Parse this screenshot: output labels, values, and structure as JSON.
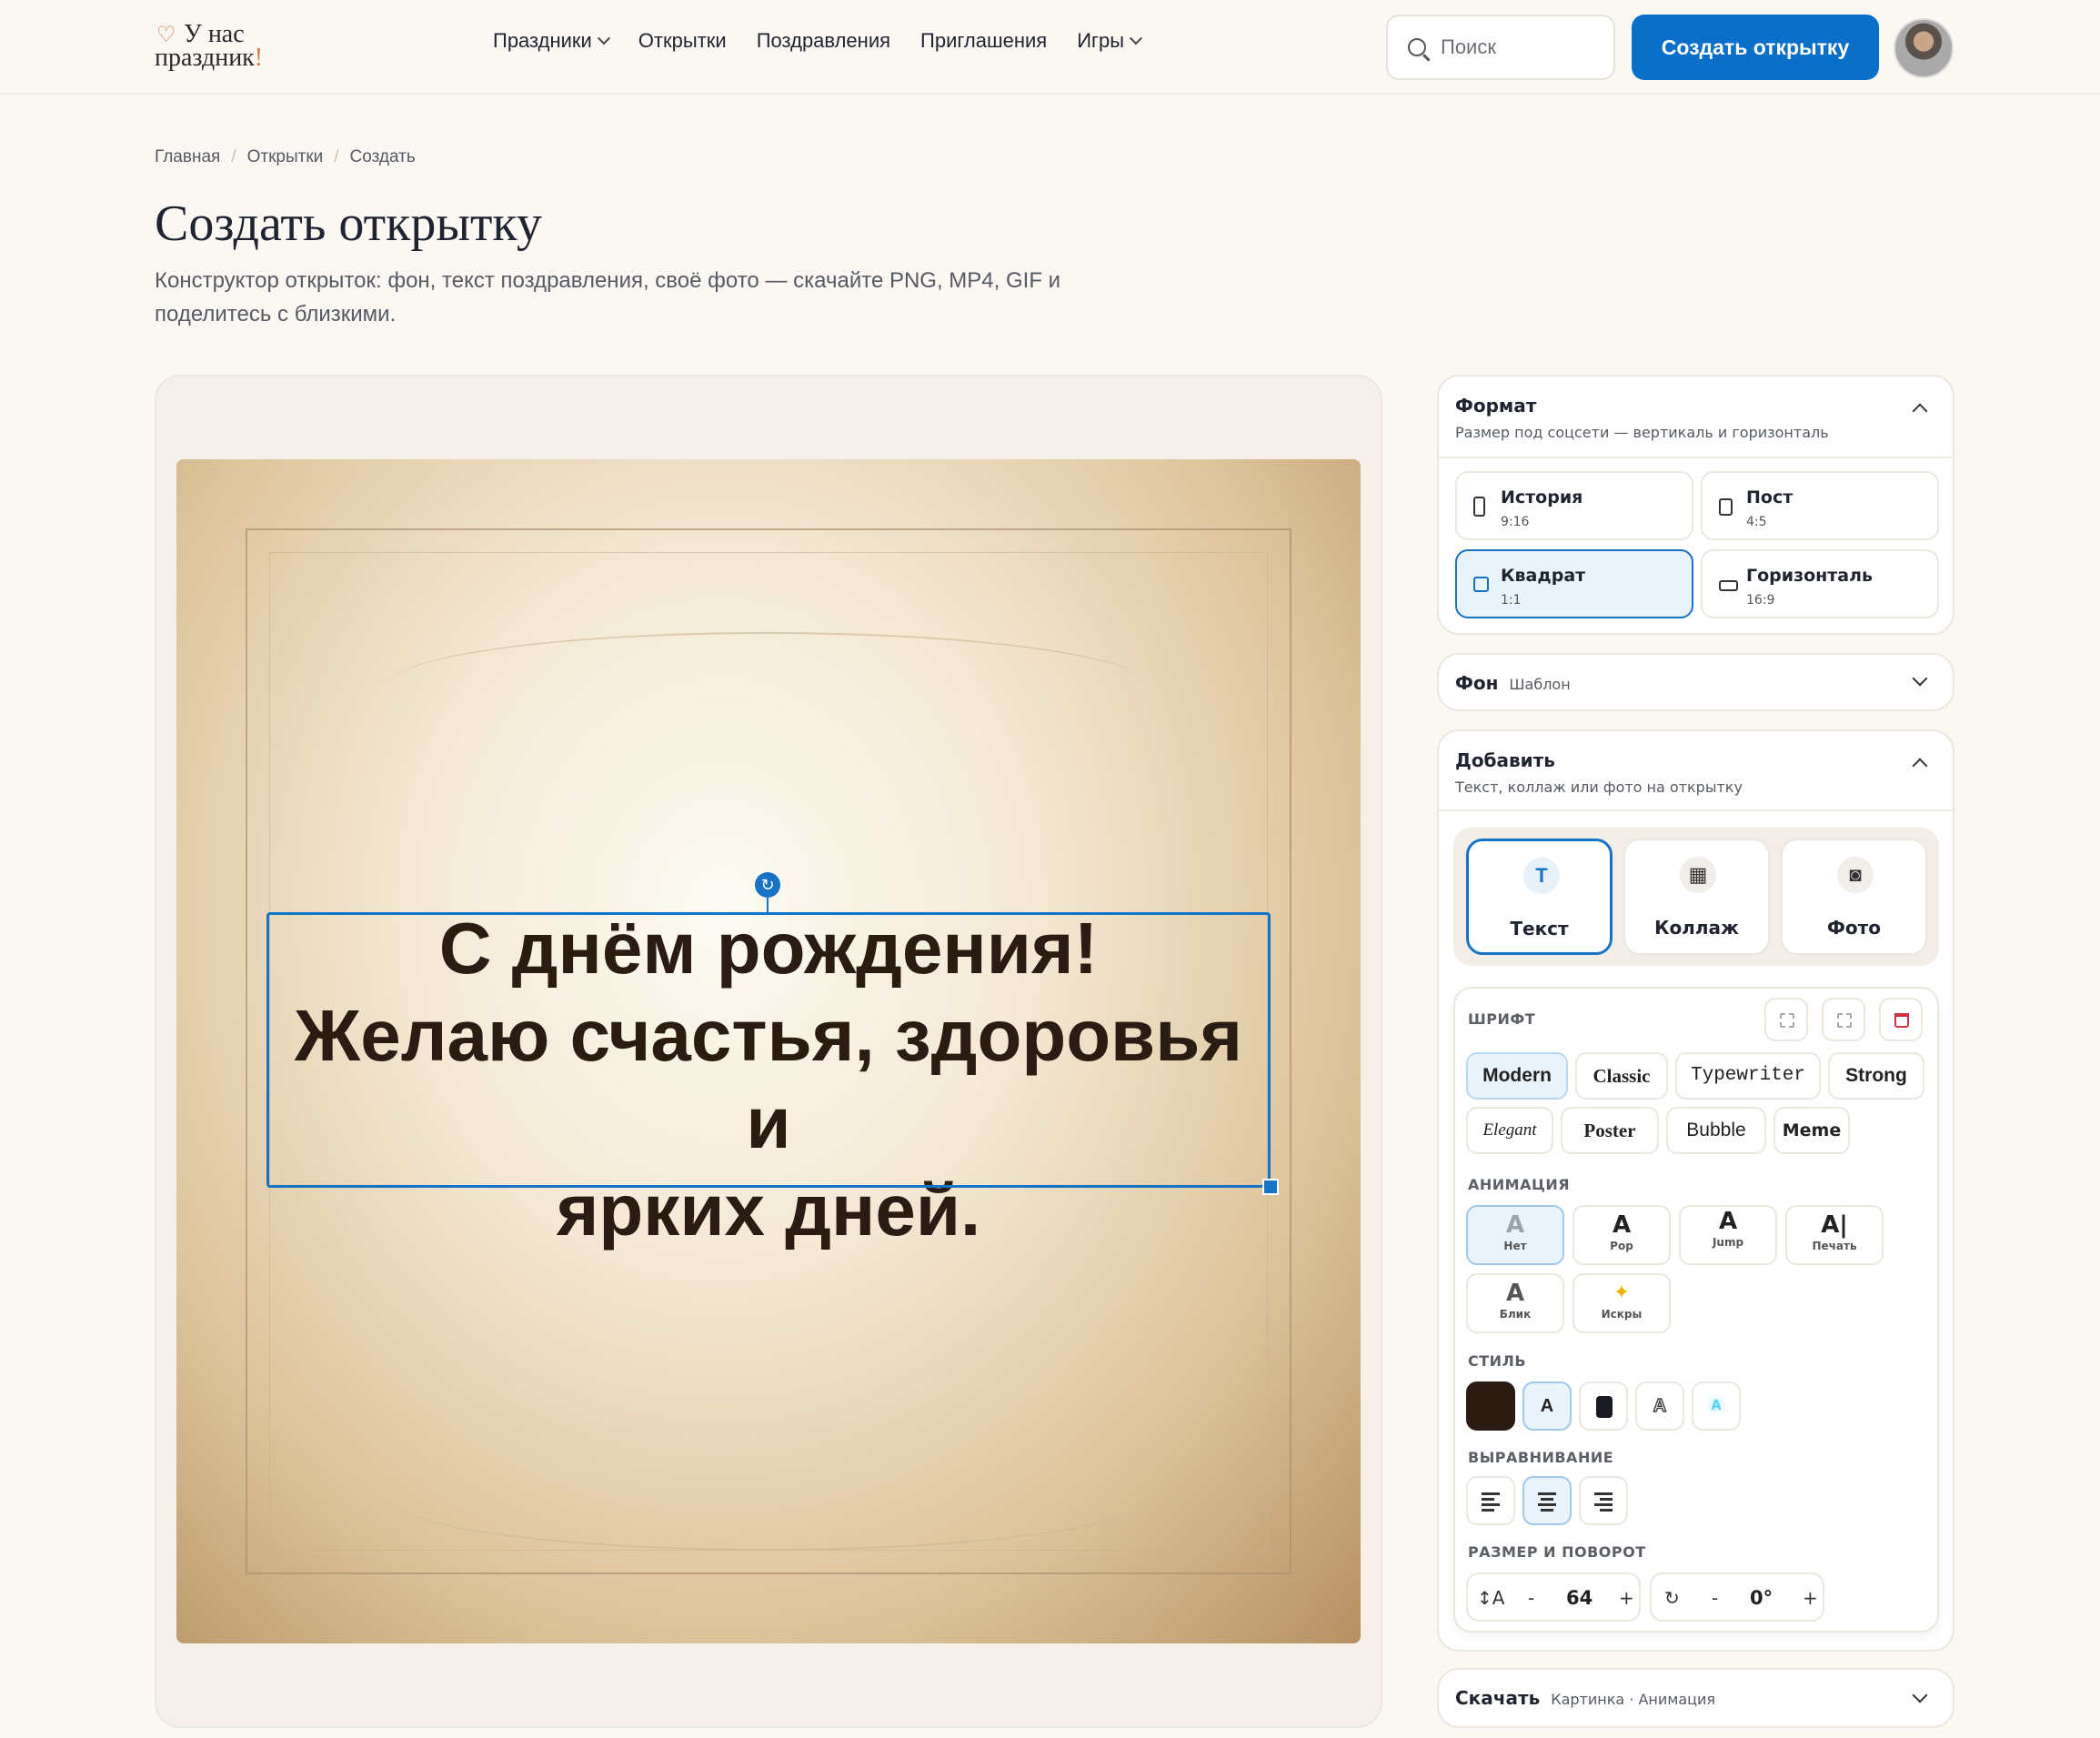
{
  "header": {
    "logo_line1": "У нас",
    "logo_line2": "праздник",
    "logo_bang": "!",
    "nav": [
      "Праздники",
      "Открытки",
      "Поздравления",
      "Приглашения",
      "Игры"
    ],
    "search_placeholder": "Поиск",
    "create_button": "Создать открытку",
    "colors": {
      "accent": "#0a6fc9",
      "logo_accent": "#d8774e"
    }
  },
  "breadcrumbs": [
    "Главная",
    "Открытки",
    "Создать"
  ],
  "page": {
    "title": "Создать открытку",
    "subtitle": "Конструктор открыток: фон, текст поздравления, своё фото — скачайте PNG, MP4, GIF и поделитесь с близкими."
  },
  "card": {
    "text_lines": [
      "С днём рождения!",
      "Желаю счастья, здоровья и",
      "ярких дней."
    ]
  },
  "sidebar": {
    "format": {
      "title": "Формат",
      "subtitle": "Размер под соцсети — вертикаль и горизонталь",
      "options": [
        {
          "name": "История",
          "ratio": "9:16"
        },
        {
          "name": "Пост",
          "ratio": "4:5"
        },
        {
          "name": "Квадрат",
          "ratio": "1:1"
        },
        {
          "name": "Горизонталь",
          "ratio": "16:9"
        }
      ],
      "selected": "Квадрат"
    },
    "background": {
      "title": "Фон",
      "value": "Шаблон"
    },
    "add": {
      "title": "Добавить",
      "subtitle": "Текст, коллаж или фото на открытку",
      "buttons": [
        "Текст",
        "Коллаж",
        "Фото"
      ],
      "selected": "Текст"
    },
    "editor": {
      "font_label": "ШРИФТ",
      "fonts_row1": [
        "Modern",
        "Classic",
        "Typewriter",
        "Strong"
      ],
      "fonts_row2": [
        "Elegant",
        "Poster",
        "Bubble",
        "Meme"
      ],
      "font_selected": "Modern",
      "animation_label": "АНИМАЦИЯ",
      "animations": [
        "Нет",
        "Pop",
        "Jump",
        "Печать",
        "Блик",
        "Искры"
      ],
      "animation_selected": "Нет",
      "style_label": "СТИЛЬ",
      "style_swatch_letter": "A",
      "align_label": "ВЫРАВНИВАНИЕ",
      "align_selected": "center",
      "size_label": "РАЗМЕР И ПОВОРОТ",
      "size_value": "64",
      "rotation_value": "0°",
      "minus": "-",
      "plus": "+"
    },
    "download": {
      "title": "Скачать",
      "value": "Картинка · Анимация"
    }
  }
}
